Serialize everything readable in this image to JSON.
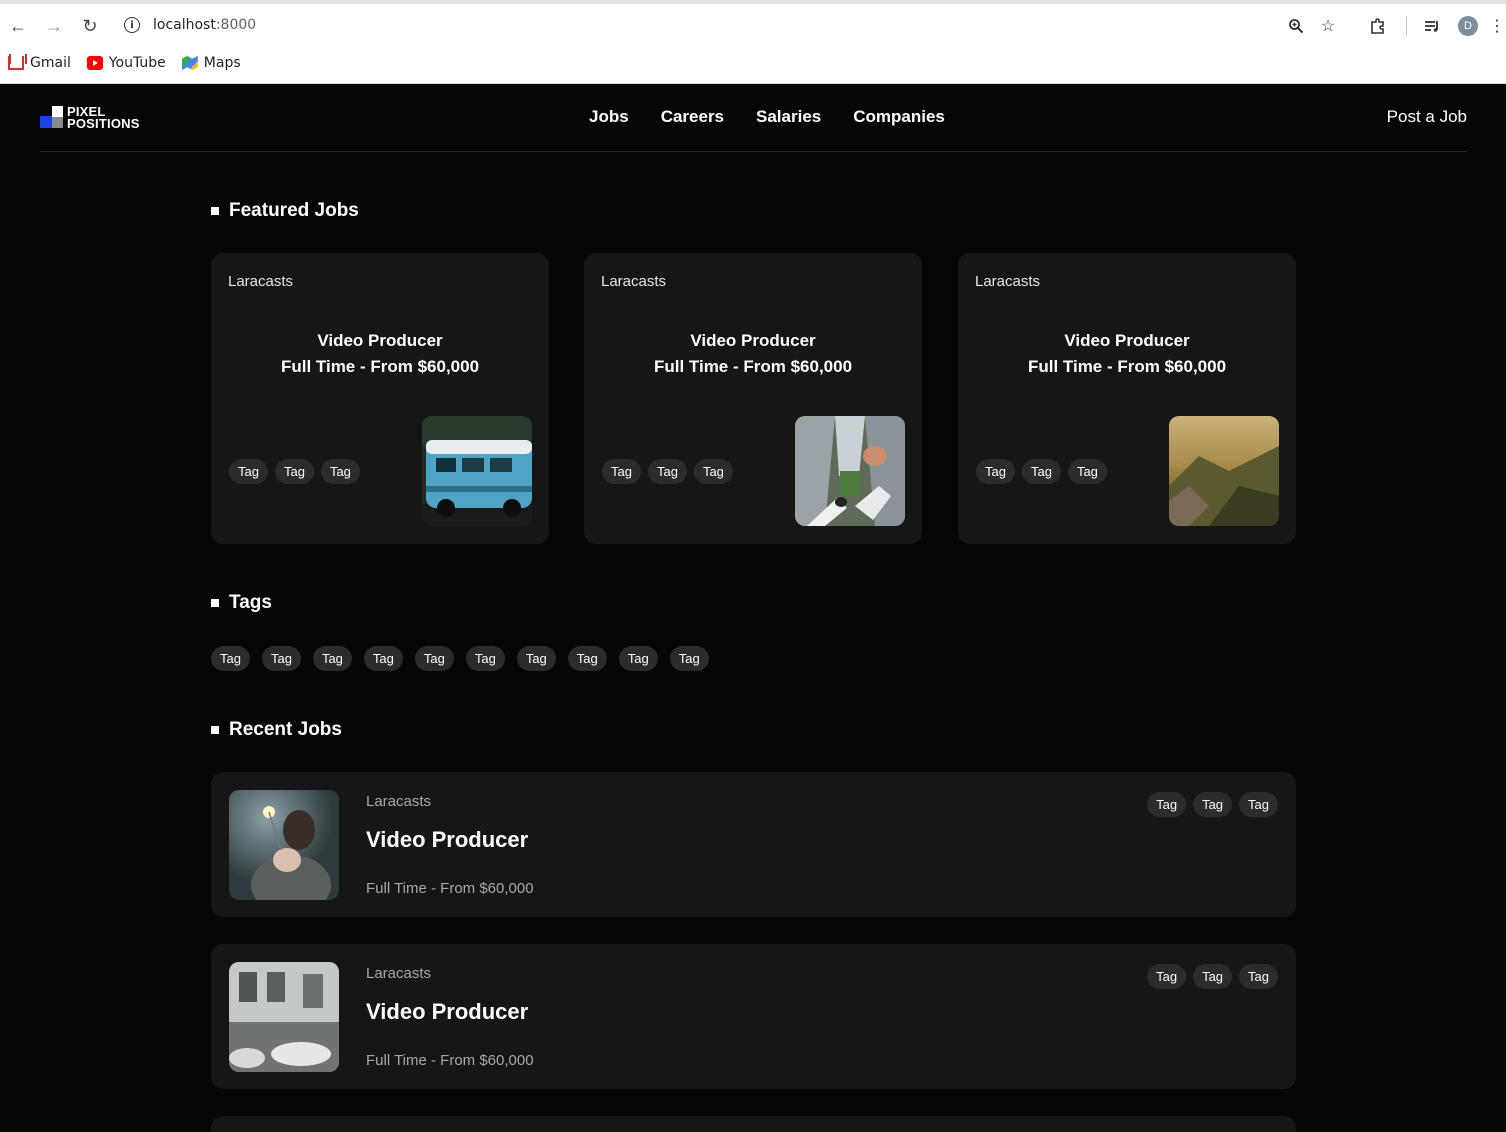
{
  "browser": {
    "url_host": "localhost",
    "url_port": ":8000",
    "avatar_letter": "D",
    "bookmarks": [
      {
        "label": "Gmail",
        "icon": "gmail-icon"
      },
      {
        "label": "YouTube",
        "icon": "youtube-icon"
      },
      {
        "label": "Maps",
        "icon": "maps-icon"
      }
    ]
  },
  "header": {
    "logo_line1": "PIXEL",
    "logo_line2": "POSITIONS",
    "nav": [
      "Jobs",
      "Careers",
      "Salaries",
      "Companies"
    ],
    "post_job": "Post a Job"
  },
  "featured": {
    "title": "Featured Jobs",
    "jobs": [
      {
        "company": "Laracasts",
        "title": "Video Producer",
        "meta": "Full Time - From $60,000",
        "tags": [
          "Tag",
          "Tag",
          "Tag"
        ],
        "image": "blue camper van"
      },
      {
        "company": "Laracasts",
        "title": "Video Producer",
        "meta": "Full Time - From $60,000",
        "tags": [
          "Tag",
          "Tag",
          "Tag"
        ],
        "image": "skyscrapers view from above"
      },
      {
        "company": "Laracasts",
        "title": "Video Producer",
        "meta": "Full Time - From $60,000",
        "tags": [
          "Tag",
          "Tag",
          "Tag"
        ],
        "image": "misty mountain cliff"
      }
    ]
  },
  "tags": {
    "title": "Tags",
    "items": [
      "Tag",
      "Tag",
      "Tag",
      "Tag",
      "Tag",
      "Tag",
      "Tag",
      "Tag",
      "Tag",
      "Tag"
    ]
  },
  "recent": {
    "title": "Recent Jobs",
    "jobs": [
      {
        "company": "Laracasts",
        "title": "Video Producer",
        "meta": "Full Time - From $60,000",
        "tags": [
          "Tag",
          "Tag",
          "Tag"
        ],
        "image": "person holding sparkler"
      },
      {
        "company": "Laracasts",
        "title": "Video Producer",
        "meta": "Full Time - From $60,000",
        "tags": [
          "Tag",
          "Tag",
          "Tag"
        ],
        "image": "old building with cars"
      }
    ]
  }
}
